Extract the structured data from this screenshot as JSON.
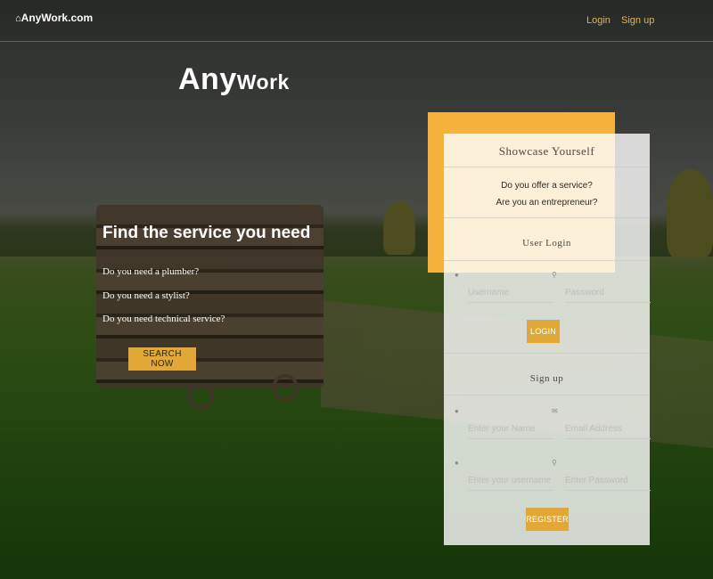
{
  "header": {
    "brand": "AnyWork.com",
    "nav": {
      "login": "Login",
      "signup": "Sign up"
    }
  },
  "hero": {
    "title_main": "Any",
    "title_small": "Work",
    "find_title": "Find the service you need",
    "questions": [
      "Do you need a plumber?",
      "Do you need a stylist?",
      "Do you need technical service?"
    ],
    "search_button": "SEARCH NOW"
  },
  "card": {
    "title": "Showcase Yourself",
    "questions": [
      "Do you offer a service?",
      "Are you an entrepreneur?"
    ],
    "login": {
      "title": "User Login",
      "username_placeholder": "Username",
      "password_placeholder": "Password",
      "button": "LOGIN"
    },
    "signup": {
      "title": "Sign up",
      "name_placeholder": "Enter your Name",
      "email_placeholder": "Email Address",
      "username_placeholder": "Enter your username",
      "password_placeholder": "Enter Password",
      "button": "REGISTER"
    }
  },
  "colors": {
    "accent": "#f5b23c",
    "button": "#e1a737",
    "link": "#f0b240"
  },
  "icons": [
    "home-icon",
    "user-icon",
    "key-icon",
    "envelope-icon"
  ]
}
